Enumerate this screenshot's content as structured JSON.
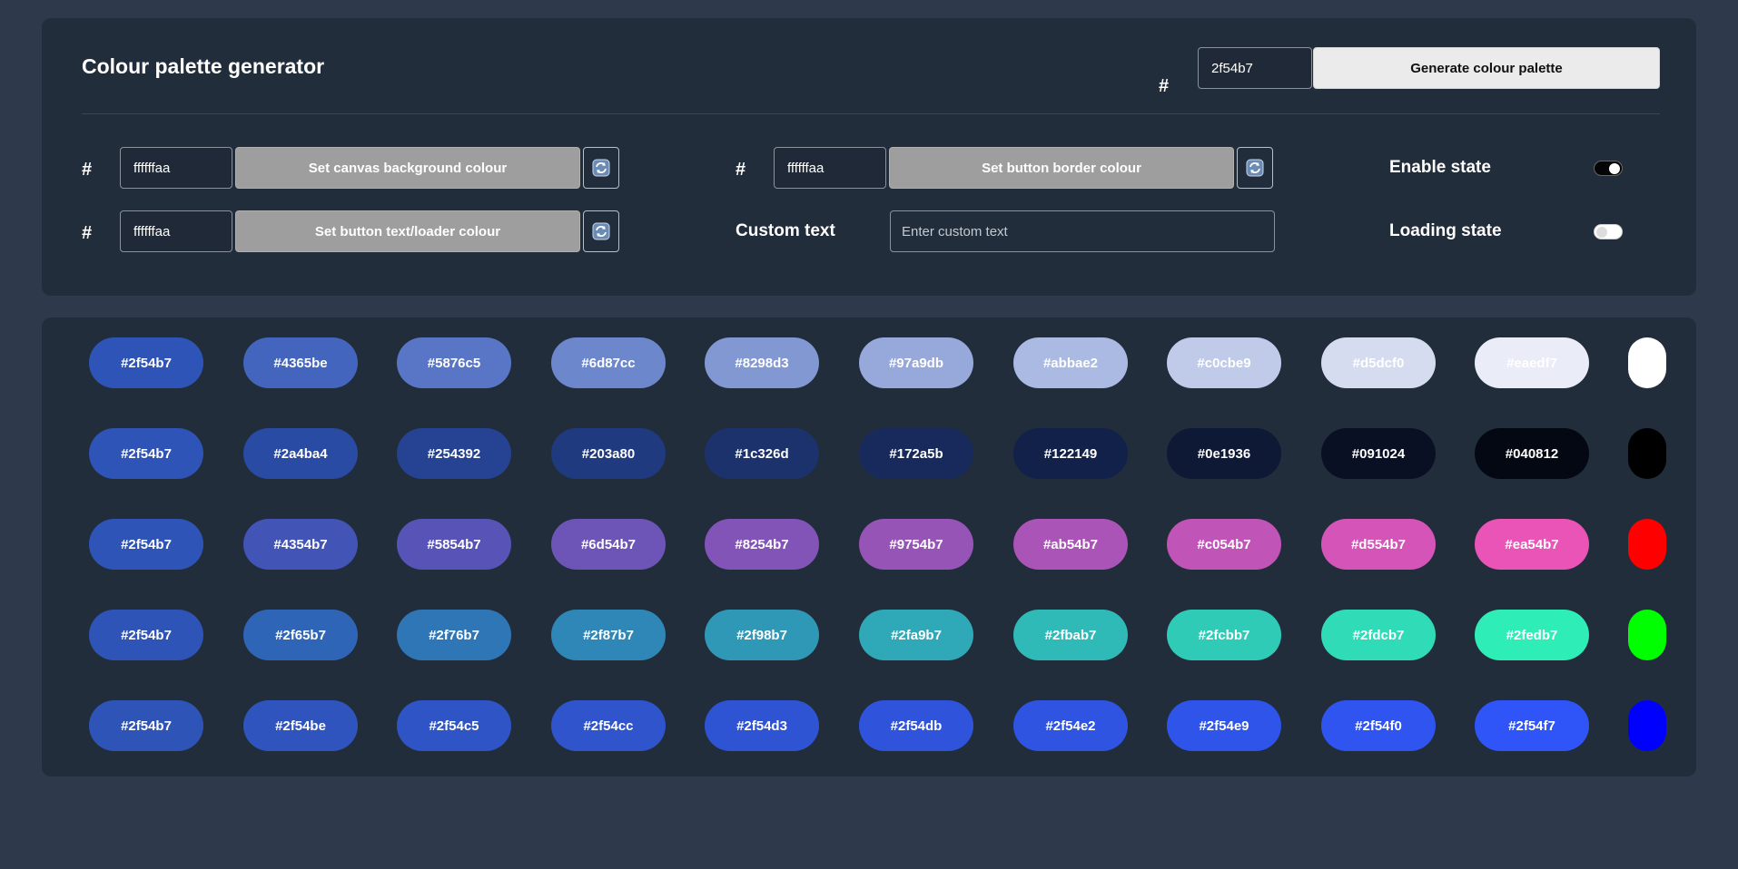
{
  "header": {
    "title": "Colour palette generator",
    "hash": "#",
    "base_colour": "2f54b7",
    "generate_label": "Generate colour palette"
  },
  "settings": {
    "hash": "#",
    "canvas_bg": {
      "value": "ffffffaa",
      "label": "Set canvas background colour"
    },
    "button_text": {
      "value": "ffffffaa",
      "label": "Set button text/loader colour"
    },
    "button_border": {
      "value": "ffffffaa",
      "label": "Set button border colour"
    },
    "custom_text": {
      "label": "Custom text",
      "placeholder": "Enter custom text"
    },
    "enable_state": {
      "label": "Enable state",
      "on": true
    },
    "loading_state": {
      "label": "Loading state",
      "on": false
    }
  },
  "icons": {
    "refresh": "refresh-icon"
  },
  "palette": [
    {
      "text_color": "#ffffff",
      "end_color": "#ffffff",
      "swatches": [
        "#2f54b7",
        "#4365be",
        "#5876c5",
        "#6d87cc",
        "#8298d3",
        "#97a9db",
        "#abbae2",
        "#c0cbe9",
        "#d5dcf0",
        "#eaedf7"
      ]
    },
    {
      "text_color": "#ffffff",
      "end_color": "#000000",
      "swatches": [
        "#2f54b7",
        "#2a4ba4",
        "#254392",
        "#203a80",
        "#1c326d",
        "#172a5b",
        "#122149",
        "#0e1936",
        "#091024",
        "#040812"
      ]
    },
    {
      "text_color": "#ffffff",
      "end_color": "#ff0000",
      "swatches": [
        "#2f54b7",
        "#4354b7",
        "#5854b7",
        "#6d54b7",
        "#8254b7",
        "#9754b7",
        "#ab54b7",
        "#c054b7",
        "#d554b7",
        "#ea54b7"
      ]
    },
    {
      "text_color": "#ffffff",
      "end_color": "#00ff00",
      "swatches": [
        "#2f54b7",
        "#2f65b7",
        "#2f76b7",
        "#2f87b7",
        "#2f98b7",
        "#2fa9b7",
        "#2fbab7",
        "#2fcbb7",
        "#2fdcb7",
        "#2fedb7"
      ]
    },
    {
      "text_color": "#ffffff",
      "end_color": "#0000ff",
      "swatches": [
        "#2f54b7",
        "#2f54be",
        "#2f54c5",
        "#2f54cc",
        "#2f54d3",
        "#2f54db",
        "#2f54e2",
        "#2f54e9",
        "#2f54f0",
        "#2f54f7"
      ]
    }
  ]
}
